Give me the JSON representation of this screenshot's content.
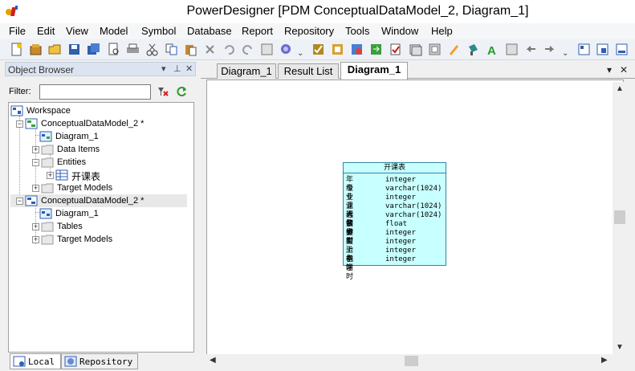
{
  "titlebar": {
    "title": "PowerDesigner [PDM ConceptualDataModel_2, Diagram_1]"
  },
  "menubar": {
    "items": [
      "File",
      "Edit",
      "View",
      "Model",
      "Symbol",
      "Database",
      "Report",
      "Repository",
      "Tools",
      "Window",
      "Help"
    ]
  },
  "object_browser": {
    "title": "Object Browser",
    "controls": [
      "▾",
      "⊥",
      "✕"
    ],
    "filter_label": "Filter:",
    "filter_value": "",
    "tree": {
      "workspace": "Workspace",
      "model1": "ConceptualDataModel_2 *",
      "model1_diagram": "Diagram_1",
      "model1_data_items": "Data Items",
      "model1_entities": "Entities",
      "model1_entity": "开课表",
      "model1_targets": "Target Models",
      "model2": "ConceptualDataModel_2 *",
      "model2_diagram": "Diagram_1",
      "model2_tables": "Tables",
      "model2_targets": "Target Models"
    },
    "tabs": [
      "Local",
      "Repository"
    ]
  },
  "document": {
    "tabs": [
      "Diagram_1",
      "Result List",
      "Diagram_1"
    ],
    "active_tab": 2,
    "controls": [
      "▾",
      "✕"
    ]
  },
  "entity": {
    "name": "开课表",
    "attributes": [
      {
        "name": "年级",
        "type": "integer"
      },
      {
        "name": "专业",
        "type": "varchar(1024)"
      },
      {
        "name": "专业人数",
        "type": "integer"
      },
      {
        "name": "课程名称",
        "type": "varchar(1024)"
      },
      {
        "name": "选修类型",
        "type": "varchar(1024)"
      },
      {
        "name": "学分",
        "type": "float"
      },
      {
        "name": "学时",
        "type": "integer"
      },
      {
        "name": "实验学时",
        "type": "integer"
      },
      {
        "name": "上机学时",
        "type": "integer"
      },
      {
        "name": "备注",
        "type": "integer"
      }
    ]
  },
  "colors": {
    "entity_fill": "#c8ffff",
    "entity_border": "#2a8aa0",
    "panel_header": "#dbe4f0"
  }
}
